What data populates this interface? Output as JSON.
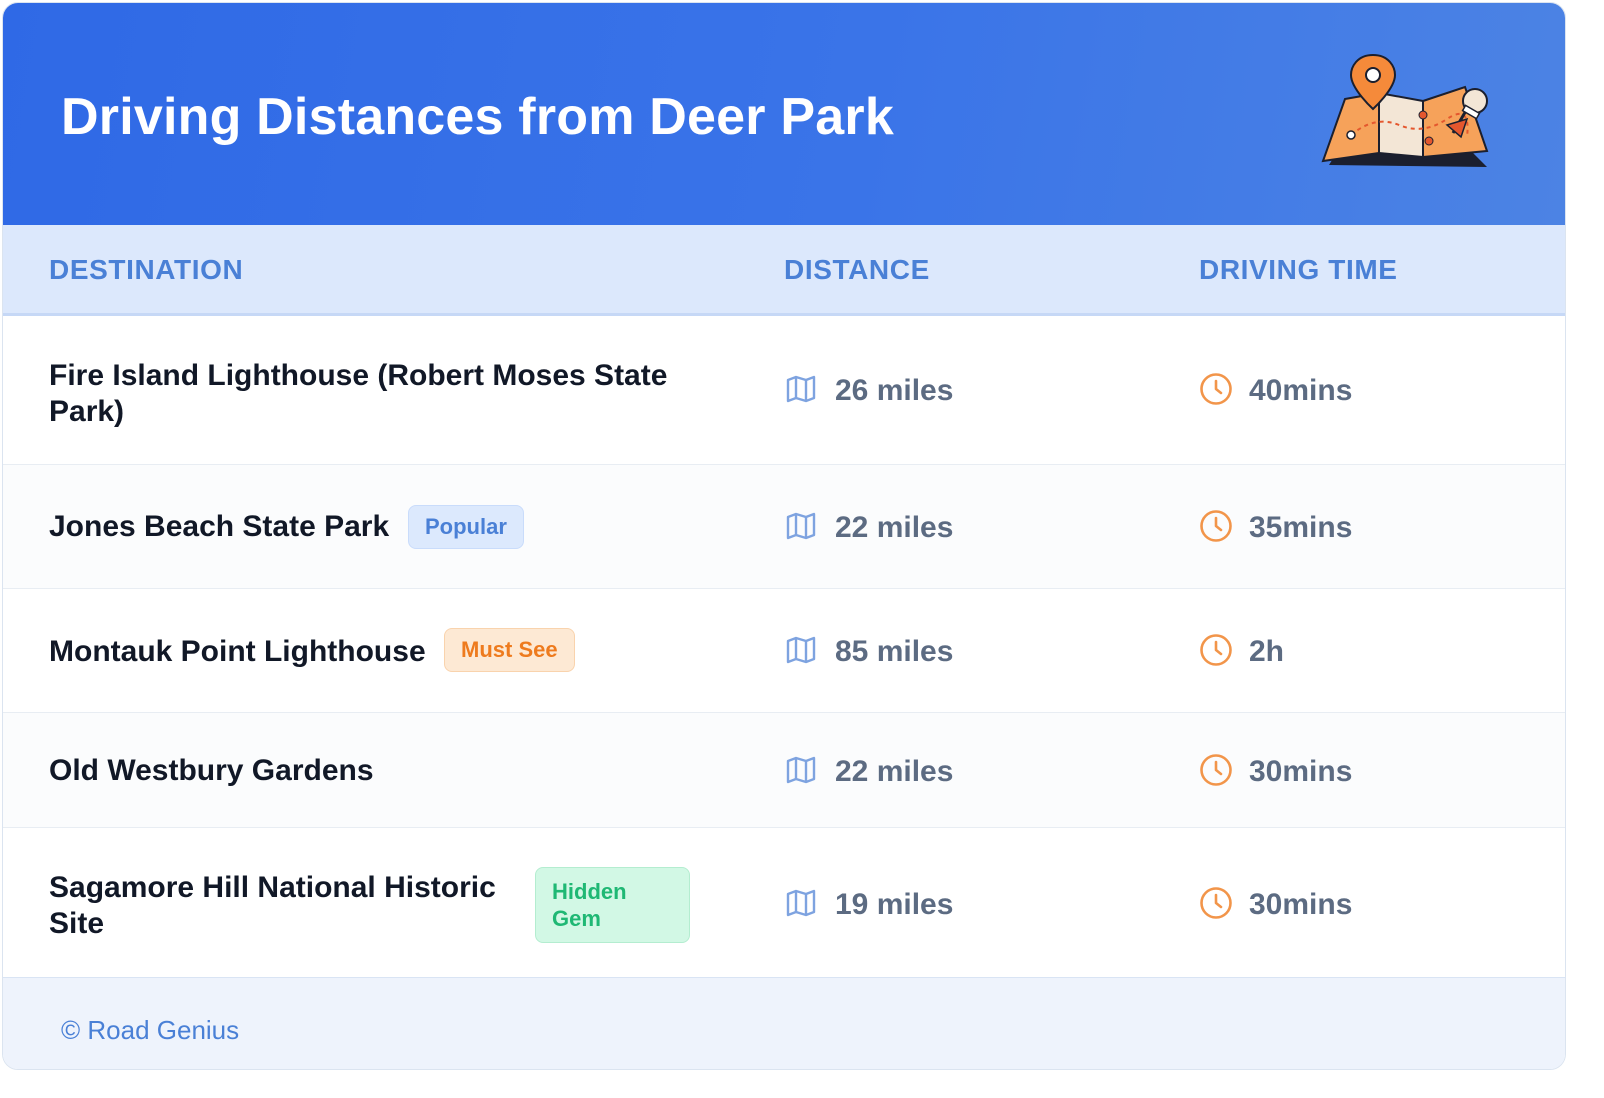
{
  "header": {
    "title": "Driving Distances from Deer Park",
    "illustration_icon": "map-with-pins-icon"
  },
  "columns": {
    "destination": "DESTINATION",
    "distance": "DISTANCE",
    "driving_time": "DRIVING TIME"
  },
  "rows": [
    {
      "destination": "Fire Island Lighthouse (Robert Moses State Park)",
      "badge": "",
      "distance": "26 miles",
      "time": "40mins"
    },
    {
      "destination": "Jones Beach State Park",
      "badge": "Popular",
      "distance": "22 miles",
      "time": "35mins"
    },
    {
      "destination": "Montauk Point Lighthouse",
      "badge": "Must See",
      "distance": "85 miles",
      "time": "2h"
    },
    {
      "destination": "Old Westbury Gardens",
      "badge": "",
      "distance": "22 miles",
      "time": "30mins"
    },
    {
      "destination": "Sagamore Hill National Historic Site",
      "badge": "Hidden Gem",
      "distance": "19 miles",
      "time": "30mins"
    }
  ],
  "icons": {
    "distance": "map-icon",
    "time": "clock-icon"
  },
  "colors": {
    "header_blue": "#2f69e6",
    "accent_blue": "#4a80d6",
    "orange": "#ee7b1e",
    "green": "#1fb874"
  },
  "footer": {
    "copyright": "© Road Genius"
  }
}
